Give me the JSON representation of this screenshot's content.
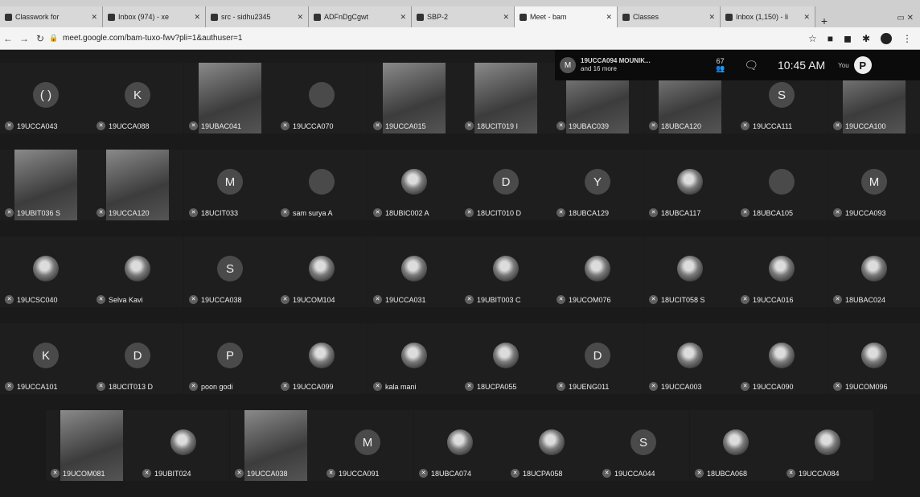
{
  "browser": {
    "tabs": [
      {
        "label": "Classwork for",
        "active": false
      },
      {
        "label": "Inbox (974) - xe",
        "active": false
      },
      {
        "label": "src - sidhu2345",
        "active": false
      },
      {
        "label": "ADFnDgCgwt",
        "active": false
      },
      {
        "label": "SBP-2",
        "active": false
      },
      {
        "label": "Meet - bam",
        "active": true
      },
      {
        "label": "Classes",
        "active": false
      },
      {
        "label": "Inbox (1,150) - li",
        "active": false
      }
    ],
    "new_tab_label": "+",
    "url": "meet.google.com/bam-tuxo-fwv?pli=1&authuser=1"
  },
  "meet": {
    "pinned_avatar_letter": "M",
    "pinned_name": "19UCCA094 MOUNIK...",
    "pinned_sub": "and 16 more",
    "people_count": "67",
    "time": "10:45 AM",
    "you_label": "You",
    "you_letter": "P",
    "participants": [
      {
        "name": "19UCCA043",
        "kind": "avatar",
        "letter": "( )"
      },
      {
        "name": "19UCCA088",
        "kind": "avatar",
        "letter": "K"
      },
      {
        "name": "19UBAC041",
        "kind": "video"
      },
      {
        "name": "19UCCA070",
        "kind": "avatar",
        "letter": ""
      },
      {
        "name": "19UCCA015",
        "kind": "video"
      },
      {
        "name": "18UCIT019 I",
        "kind": "video"
      },
      {
        "name": "19UBAC039",
        "kind": "video"
      },
      {
        "name": "18UBCA120",
        "kind": "video"
      },
      {
        "name": "19UCCA111",
        "kind": "avatar",
        "letter": "S"
      },
      {
        "name": "19UCCA100",
        "kind": "video"
      },
      {
        "name": "19UBIT036 S",
        "kind": "video"
      },
      {
        "name": "19UCCA120",
        "kind": "video"
      },
      {
        "name": "18UCIT033",
        "kind": "avatar",
        "letter": "M"
      },
      {
        "name": "sam surya A",
        "kind": "avatar",
        "letter": ""
      },
      {
        "name": "18UBIC002 A",
        "kind": "img"
      },
      {
        "name": "18UCIT010 D",
        "kind": "avatar",
        "letter": "D"
      },
      {
        "name": "18UBCA129",
        "kind": "avatar",
        "letter": "Y"
      },
      {
        "name": "18UBCA117",
        "kind": "img"
      },
      {
        "name": "18UBCA105",
        "kind": "avatar",
        "letter": ""
      },
      {
        "name": "19UCCA093",
        "kind": "avatar",
        "letter": "M"
      },
      {
        "name": "19UCSC040",
        "kind": "img"
      },
      {
        "name": "Selva Kavi",
        "kind": "img"
      },
      {
        "name": "19UCCA038",
        "kind": "avatar",
        "letter": "S"
      },
      {
        "name": "19UCOM104",
        "kind": "img"
      },
      {
        "name": "19UCCA031",
        "kind": "img"
      },
      {
        "name": "19UBIT003 C",
        "kind": "img"
      },
      {
        "name": "19UCOM076",
        "kind": "img"
      },
      {
        "name": "18UCIT058 S",
        "kind": "img"
      },
      {
        "name": "19UCCA016",
        "kind": "img"
      },
      {
        "name": "18UBAC024",
        "kind": "img"
      },
      {
        "name": "19UCCA101",
        "kind": "avatar",
        "letter": "K"
      },
      {
        "name": "18UCIT013 D",
        "kind": "avatar",
        "letter": "D"
      },
      {
        "name": "poon godi",
        "kind": "avatar",
        "letter": "P"
      },
      {
        "name": "19UCCA099",
        "kind": "img"
      },
      {
        "name": "kala mani",
        "kind": "img"
      },
      {
        "name": "18UCPA055",
        "kind": "img"
      },
      {
        "name": "19UENG011",
        "kind": "avatar",
        "letter": "D"
      },
      {
        "name": "19UCCA003",
        "kind": "img"
      },
      {
        "name": "19UCCA090",
        "kind": "img"
      },
      {
        "name": "19UCOM096",
        "kind": "img"
      },
      {
        "name": "19UCOM081",
        "kind": "video"
      },
      {
        "name": "19UBIT024",
        "kind": "img"
      },
      {
        "name": "19UCCA038",
        "kind": "video"
      },
      {
        "name": "19UCCA091",
        "kind": "avatar",
        "letter": "M"
      },
      {
        "name": "18UBCA074",
        "kind": "img"
      },
      {
        "name": "18UCPA058",
        "kind": "img"
      },
      {
        "name": "19UCCA044",
        "kind": "avatar",
        "letter": "S"
      },
      {
        "name": "18UBCA068",
        "kind": "img"
      },
      {
        "name": "19UCCA084",
        "kind": "img"
      }
    ]
  }
}
